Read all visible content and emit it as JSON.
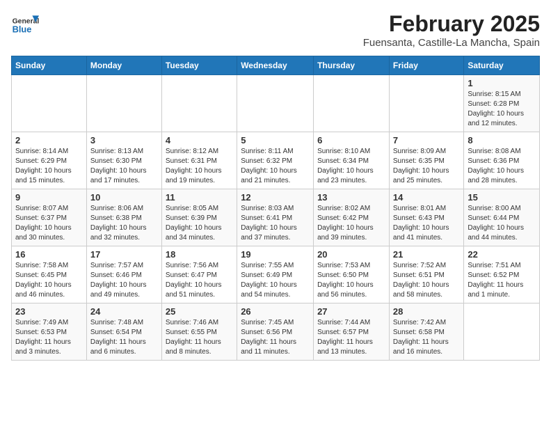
{
  "header": {
    "logo_general": "General",
    "logo_blue": "Blue",
    "main_title": "February 2025",
    "subtitle": "Fuensanta, Castille-La Mancha, Spain"
  },
  "days_of_week": [
    "Sunday",
    "Monday",
    "Tuesday",
    "Wednesday",
    "Thursday",
    "Friday",
    "Saturday"
  ],
  "weeks": [
    [
      {
        "day": "",
        "info": ""
      },
      {
        "day": "",
        "info": ""
      },
      {
        "day": "",
        "info": ""
      },
      {
        "day": "",
        "info": ""
      },
      {
        "day": "",
        "info": ""
      },
      {
        "day": "",
        "info": ""
      },
      {
        "day": "1",
        "info": "Sunrise: 8:15 AM\nSunset: 6:28 PM\nDaylight: 10 hours and 12 minutes."
      }
    ],
    [
      {
        "day": "2",
        "info": "Sunrise: 8:14 AM\nSunset: 6:29 PM\nDaylight: 10 hours and 15 minutes."
      },
      {
        "day": "3",
        "info": "Sunrise: 8:13 AM\nSunset: 6:30 PM\nDaylight: 10 hours and 17 minutes."
      },
      {
        "day": "4",
        "info": "Sunrise: 8:12 AM\nSunset: 6:31 PM\nDaylight: 10 hours and 19 minutes."
      },
      {
        "day": "5",
        "info": "Sunrise: 8:11 AM\nSunset: 6:32 PM\nDaylight: 10 hours and 21 minutes."
      },
      {
        "day": "6",
        "info": "Sunrise: 8:10 AM\nSunset: 6:34 PM\nDaylight: 10 hours and 23 minutes."
      },
      {
        "day": "7",
        "info": "Sunrise: 8:09 AM\nSunset: 6:35 PM\nDaylight: 10 hours and 25 minutes."
      },
      {
        "day": "8",
        "info": "Sunrise: 8:08 AM\nSunset: 6:36 PM\nDaylight: 10 hours and 28 minutes."
      }
    ],
    [
      {
        "day": "9",
        "info": "Sunrise: 8:07 AM\nSunset: 6:37 PM\nDaylight: 10 hours and 30 minutes."
      },
      {
        "day": "10",
        "info": "Sunrise: 8:06 AM\nSunset: 6:38 PM\nDaylight: 10 hours and 32 minutes."
      },
      {
        "day": "11",
        "info": "Sunrise: 8:05 AM\nSunset: 6:39 PM\nDaylight: 10 hours and 34 minutes."
      },
      {
        "day": "12",
        "info": "Sunrise: 8:03 AM\nSunset: 6:41 PM\nDaylight: 10 hours and 37 minutes."
      },
      {
        "day": "13",
        "info": "Sunrise: 8:02 AM\nSunset: 6:42 PM\nDaylight: 10 hours and 39 minutes."
      },
      {
        "day": "14",
        "info": "Sunrise: 8:01 AM\nSunset: 6:43 PM\nDaylight: 10 hours and 41 minutes."
      },
      {
        "day": "15",
        "info": "Sunrise: 8:00 AM\nSunset: 6:44 PM\nDaylight: 10 hours and 44 minutes."
      }
    ],
    [
      {
        "day": "16",
        "info": "Sunrise: 7:58 AM\nSunset: 6:45 PM\nDaylight: 10 hours and 46 minutes."
      },
      {
        "day": "17",
        "info": "Sunrise: 7:57 AM\nSunset: 6:46 PM\nDaylight: 10 hours and 49 minutes."
      },
      {
        "day": "18",
        "info": "Sunrise: 7:56 AM\nSunset: 6:47 PM\nDaylight: 10 hours and 51 minutes."
      },
      {
        "day": "19",
        "info": "Sunrise: 7:55 AM\nSunset: 6:49 PM\nDaylight: 10 hours and 54 minutes."
      },
      {
        "day": "20",
        "info": "Sunrise: 7:53 AM\nSunset: 6:50 PM\nDaylight: 10 hours and 56 minutes."
      },
      {
        "day": "21",
        "info": "Sunrise: 7:52 AM\nSunset: 6:51 PM\nDaylight: 10 hours and 58 minutes."
      },
      {
        "day": "22",
        "info": "Sunrise: 7:51 AM\nSunset: 6:52 PM\nDaylight: 11 hours and 1 minute."
      }
    ],
    [
      {
        "day": "23",
        "info": "Sunrise: 7:49 AM\nSunset: 6:53 PM\nDaylight: 11 hours and 3 minutes."
      },
      {
        "day": "24",
        "info": "Sunrise: 7:48 AM\nSunset: 6:54 PM\nDaylight: 11 hours and 6 minutes."
      },
      {
        "day": "25",
        "info": "Sunrise: 7:46 AM\nSunset: 6:55 PM\nDaylight: 11 hours and 8 minutes."
      },
      {
        "day": "26",
        "info": "Sunrise: 7:45 AM\nSunset: 6:56 PM\nDaylight: 11 hours and 11 minutes."
      },
      {
        "day": "27",
        "info": "Sunrise: 7:44 AM\nSunset: 6:57 PM\nDaylight: 11 hours and 13 minutes."
      },
      {
        "day": "28",
        "info": "Sunrise: 7:42 AM\nSunset: 6:58 PM\nDaylight: 11 hours and 16 minutes."
      },
      {
        "day": "",
        "info": ""
      }
    ]
  ]
}
